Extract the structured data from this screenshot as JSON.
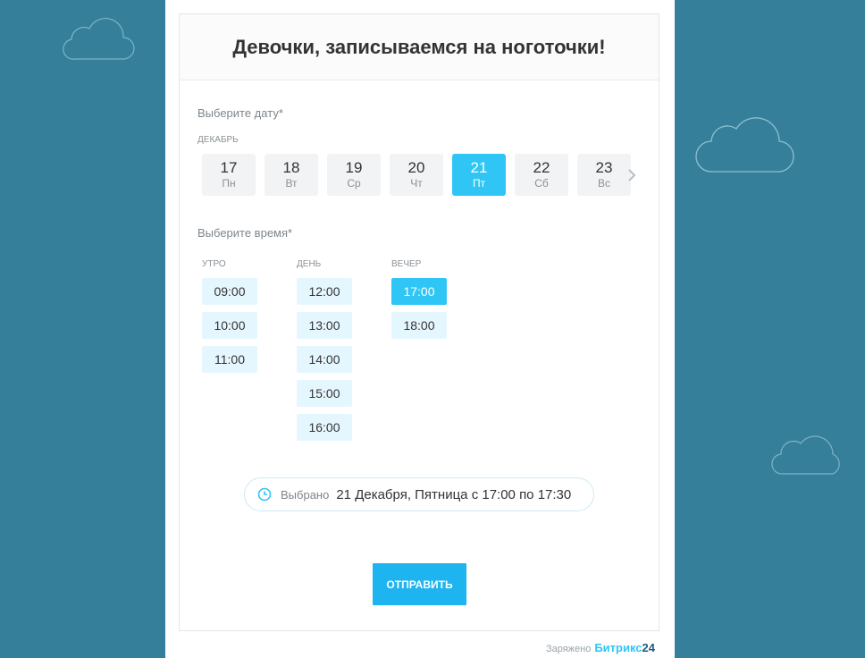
{
  "form": {
    "title": "Девочки, записываемся на ноготочки!",
    "date_label": "Выберите дату*",
    "month": "Декабрь",
    "time_label": "Выберите время*",
    "submit_label": "ОТПРАВИТЬ"
  },
  "dates": [
    {
      "num": "17",
      "dow": "Пн"
    },
    {
      "num": "18",
      "dow": "Вт"
    },
    {
      "num": "19",
      "dow": "Ср"
    },
    {
      "num": "20",
      "dow": "Чт"
    },
    {
      "num": "21",
      "dow": "Пт"
    },
    {
      "num": "22",
      "dow": "Сб"
    },
    {
      "num": "23",
      "dow": "Вс"
    }
  ],
  "selected_date_index": 4,
  "periods": [
    {
      "name": "Утро",
      "slots": [
        "09:00",
        "10:00",
        "11:00"
      ]
    },
    {
      "name": "День",
      "slots": [
        "12:00",
        "13:00",
        "14:00",
        "15:00",
        "16:00"
      ]
    },
    {
      "name": "Вечер",
      "slots": [
        "17:00",
        "18:00"
      ]
    }
  ],
  "selected_slot": "17:00",
  "summary": {
    "label": "Выбрано",
    "value": "21 Декабря, Пятница с 17:00 по 17:30"
  },
  "footer": {
    "prefix": "Заряжено",
    "brand": "Битрикс",
    "brand_suffix": "24"
  },
  "colors": {
    "background": "#357f9a",
    "accent": "#2fc6f6",
    "slot_bg": "#e5f7fe"
  },
  "icons": {
    "clock": "clock-icon",
    "next": "chevron-right-icon",
    "cloud": "cloud-icon"
  }
}
